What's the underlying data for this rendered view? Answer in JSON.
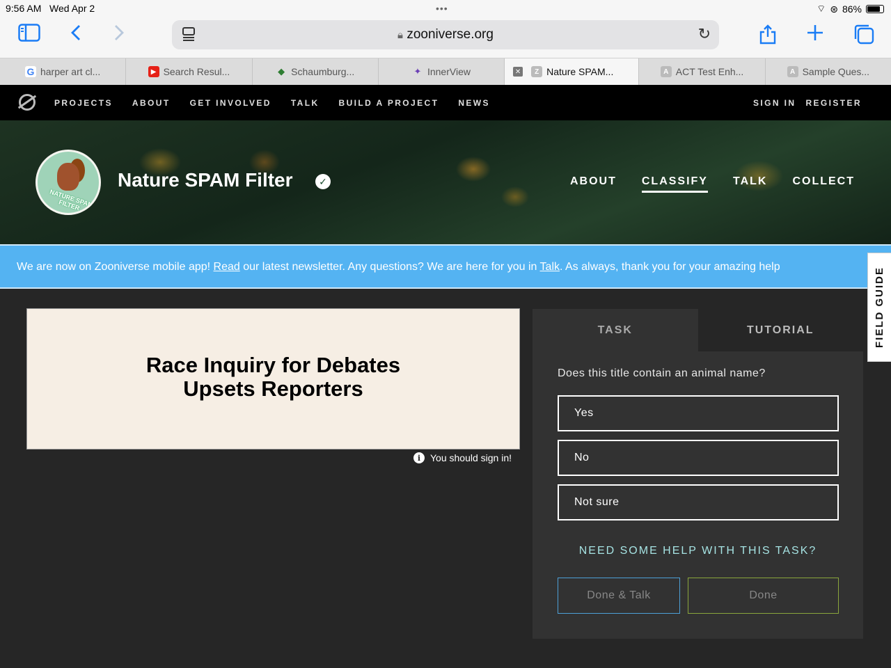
{
  "status_bar": {
    "time": "9:56 AM",
    "date": "Wed Apr 2",
    "battery": "86%"
  },
  "browser": {
    "url": "zooniverse.org",
    "tabs": [
      {
        "label": "harper art cl...",
        "favicon": "G",
        "favicon_color": "#4285f4"
      },
      {
        "label": "Search Resul...",
        "favicon": "▶",
        "favicon_color": "#e62117"
      },
      {
        "label": "Schaumburg...",
        "favicon": "◆",
        "favicon_color": "#2e7d32"
      },
      {
        "label": "InnerView",
        "favicon": "✦",
        "favicon_color": "#6a3fb5"
      },
      {
        "label": "Nature SPAM...",
        "favicon": "Z",
        "favicon_color": "#bbbbbb"
      },
      {
        "label": "ACT Test Enh...",
        "favicon": "A",
        "favicon_color": "#bbbbbb"
      },
      {
        "label": "Sample Ques...",
        "favicon": "A",
        "favicon_color": "#bbbbbb"
      }
    ]
  },
  "site_nav": {
    "links": [
      "PROJECTS",
      "ABOUT",
      "GET INVOLVED",
      "TALK",
      "BUILD A PROJECT",
      "NEWS"
    ],
    "sign_in": "SIGN IN",
    "register": "REGISTER"
  },
  "project": {
    "title": "Nature SPAM Filter",
    "avatar_text": "NATURE SPAM FILTER",
    "nav": [
      "ABOUT",
      "CLASSIFY",
      "TALK",
      "COLLECT"
    ],
    "active_nav": "CLASSIFY"
  },
  "banner": {
    "part1": "We are now on Zooniverse mobile app! ",
    "link1": "Read",
    "part2": " our latest newsletter. Any questions? We are here for you in ",
    "link2": "Talk",
    "part3": ". As always, thank you for your amazing help"
  },
  "field_guide": "FIELD GUIDE",
  "subject": {
    "text": "Race Inquiry for Debates Upsets Reporters",
    "sign_in_note": "You should sign in!"
  },
  "task": {
    "tabs": [
      "TASK",
      "TUTORIAL"
    ],
    "question": "Does this title contain an animal name?",
    "answers": [
      "Yes",
      "No",
      "Not sure"
    ],
    "help": "NEED SOME HELP WITH THIS TASK?",
    "done_talk": "Done & Talk",
    "done": "Done"
  }
}
